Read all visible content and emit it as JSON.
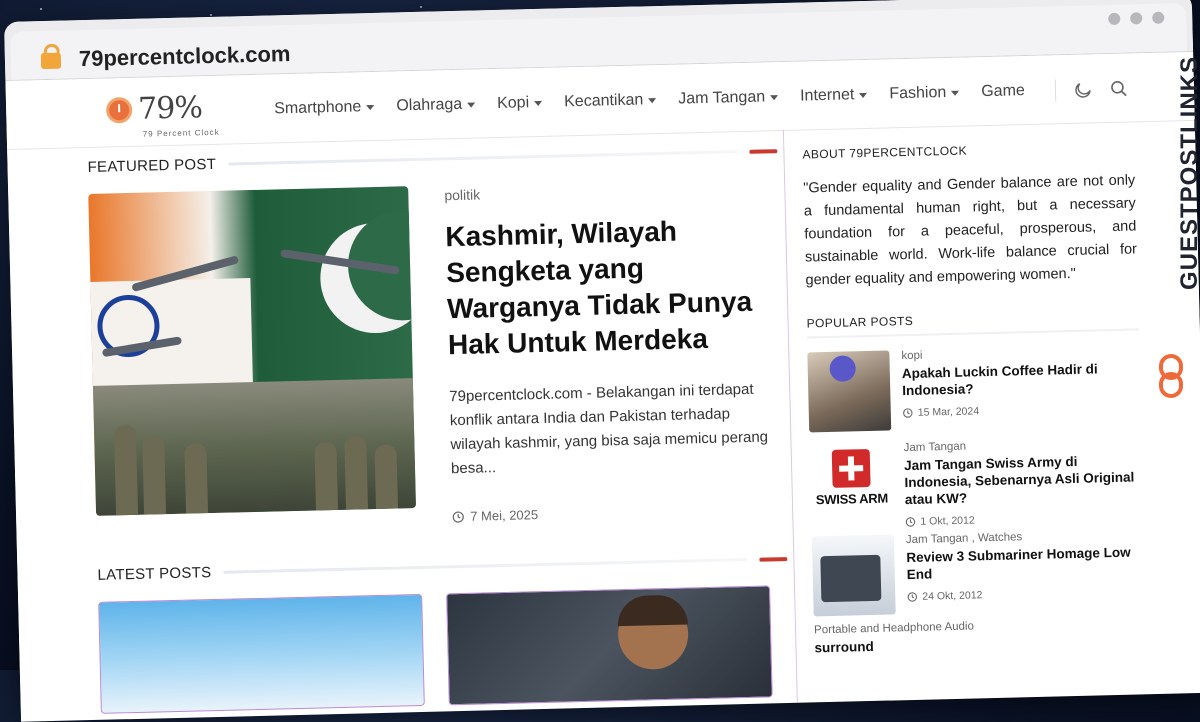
{
  "browser": {
    "url": "79percentclock.com"
  },
  "site": {
    "logo_main": "79%",
    "logo_sub": "79 Percent Clock",
    "nav": [
      {
        "label": "Smartphone",
        "dropdown": true
      },
      {
        "label": "Olahraga",
        "dropdown": true
      },
      {
        "label": "Kopi",
        "dropdown": true
      },
      {
        "label": "Kecantikan",
        "dropdown": true
      },
      {
        "label": "Jam Tangan",
        "dropdown": true
      },
      {
        "label": "Internet",
        "dropdown": true
      },
      {
        "label": "Fashion",
        "dropdown": true
      },
      {
        "label": "Game",
        "dropdown": false
      }
    ]
  },
  "featured": {
    "section_title": "FEATURED POST",
    "category": "politik",
    "title": "Kashmir, Wilayah Sengketa yang Warganya Tidak Punya Hak Untuk Merdeka",
    "excerpt": "79percentclock.com - Belakangan ini terdapat konflik antara India dan Pakistan terhadap wilayah kashmir, yang bisa saja memicu perang besa...",
    "date": "7 Mei, 2025"
  },
  "latest": {
    "section_title": "LATEST POSTS"
  },
  "sidebar": {
    "about_title": "ABOUT 79PERCENTCLOCK",
    "about_text": "\"Gender equality and Gender balance are not only a fundamental human right, but a necessary foundation for a peaceful, prosperous, and sustainable world. Work-life balance crucial for gender equality and empowering women.\"",
    "popular_title": "POPULAR POSTS",
    "popular": [
      {
        "category": "kopi",
        "title": "Apakah Luckin Coffee Hadir di Indonesia?",
        "date": "15 Mar, 2024"
      },
      {
        "category": "Jam Tangan",
        "title": "Jam Tangan Swiss Army di Indonesia, Sebenarnya Asli Original atau KW?",
        "date": "1 Okt, 2012",
        "thumb_text": "SWISS ARM"
      },
      {
        "category": "Jam Tangan , Watches",
        "title": "Review 3 Submariner Homage Low End",
        "date": "24 Okt, 2012"
      },
      {
        "category": "Portable and Headphone Audio",
        "title": "surround",
        "date": ""
      }
    ]
  },
  "watermark": {
    "text": "GUESTPOSTLINKS"
  },
  "colors": {
    "accent": "#c83a2f",
    "logo_orange": "#e8703a",
    "lock": "#f2a53a"
  }
}
